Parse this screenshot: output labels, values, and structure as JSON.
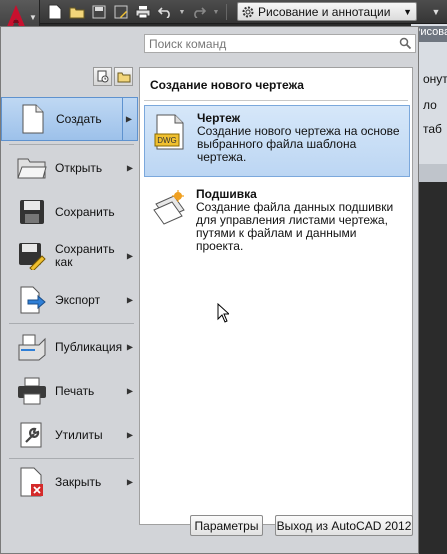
{
  "workspace": {
    "label": "Рисование и аннотации"
  },
  "ribbon_peek": {
    "tab": "Рисован",
    "lines": [
      "онуть",
      "ло",
      "таб"
    ]
  },
  "search": {
    "placeholder": "Поиск команд"
  },
  "menu": {
    "items": [
      {
        "id": "create",
        "label": "Создать",
        "has_arrow": true
      },
      {
        "id": "open",
        "label": "Открыть",
        "has_arrow": true
      },
      {
        "id": "save",
        "label": "Сохранить",
        "has_arrow": false
      },
      {
        "id": "saveas",
        "label": "Сохранить как",
        "has_arrow": true
      },
      {
        "id": "export",
        "label": "Экспорт",
        "has_arrow": true
      },
      {
        "id": "publish",
        "label": "Публикация",
        "has_arrow": true
      },
      {
        "id": "print",
        "label": "Печать",
        "has_arrow": true
      },
      {
        "id": "utils",
        "label": "Утилиты",
        "has_arrow": true
      },
      {
        "id": "close",
        "label": "Закрыть",
        "has_arrow": true
      }
    ]
  },
  "submenu": {
    "title": "Создание нового чертежа",
    "options": [
      {
        "title": "Чертеж",
        "desc": "Создание нового чертежа на основе выбранного файла шаблона чертежа.",
        "icon": "dwg-file-icon"
      },
      {
        "title": "Подшивка",
        "desc": "Создание файла данных подшивки для управления листами чертежа, путями к файлам и данными проекта.",
        "icon": "sheet-set-icon"
      }
    ]
  },
  "footer": {
    "options_label": "Параметры",
    "exit_label": "Выход из AutoCAD 2012"
  },
  "colors": {
    "selection": "#bcd6f3",
    "app_red": "#c8102e"
  }
}
